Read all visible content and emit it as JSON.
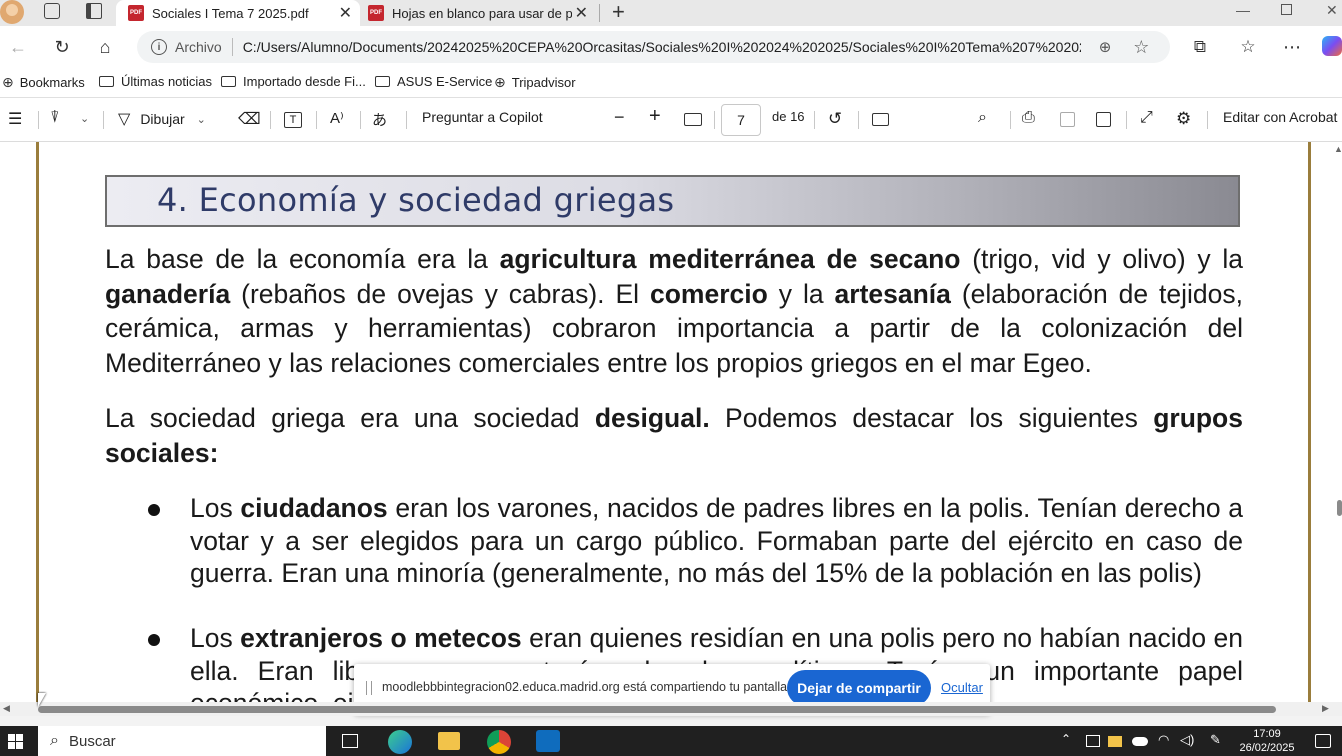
{
  "tabs": [
    {
      "title": "Sociales I Tema 7 2025.pdf",
      "active": true
    },
    {
      "title": "Hojas en blanco para usar de piza",
      "active": false
    }
  ],
  "address": {
    "scheme_label": "Archivo",
    "url": "C:/Users/Alumno/Documents/20242025%20CEPA%20Orcasitas/Sociales%20I%202024%202025/Sociales%20I%20Tema%207%202025..."
  },
  "bookmarks": {
    "items": [
      "Bookmarks",
      "Últimas noticias",
      "Importado desde Fi...",
      "ASUS E-Service",
      "Tripadvisor"
    ]
  },
  "pdf_toolbar": {
    "draw_label": "Dibujar",
    "copilot_label": "Preguntar a Copilot",
    "page_current": "7",
    "page_total_label": "de 16",
    "edit_acrobat_label": "Editar con Acrobat"
  },
  "document": {
    "heading": "4. Economía y sociedad griegas",
    "para1": {
      "s1": "La base de la economía era la ",
      "b1": "agricultura mediterránea de secano",
      "s2": " (trigo, vid y olivo) y la ",
      "b2": "ganadería",
      "s3": " (rebaños de ovejas y cabras). El ",
      "b3": "comercio",
      "s4": " y la ",
      "b4": "artesanía",
      "s5": " (elaboración de tejidos, cerámica, armas y herramientas) cobraron importancia a partir de la colonización del Mediterráneo y las relaciones comerciales entre los propios griegos en el mar Egeo."
    },
    "para2": {
      "s1": "La sociedad griega era una sociedad ",
      "b1": "desigual.",
      "s2": " Podemos destacar los siguientes ",
      "b2": "grupos sociales",
      "s3": ":"
    },
    "bullet1": {
      "s1": "Los ",
      "b1": "ciudadanos",
      "s2": " eran los varones, nacidos de padres libres en la polis. Tenían derecho a votar y a ser elegidos para un cargo público. Formaban parte del ejército en caso de guerra. Eran una minoría (generalmente, no más del 15% de la población en las polis)"
    },
    "bullet2": {
      "s1": "Los ",
      "b1": "extranjeros o metecos",
      "s2": " eran quienes residían en una polis pero no habían nacido en ella. Eran libres, pero no tenían derechos políticos. Tenían un importante papel económico, ejerciendo el comercio y dueños de talleres artesanos."
    }
  },
  "share_notice": {
    "message": "moodlebbbintegracion02.educa.madrid.org está compartiendo tu pantalla.",
    "stop_label": "Dejar de compartir",
    "hide_label": "Ocultar"
  },
  "taskbar": {
    "search_label": "Buscar",
    "time": "17:09",
    "date": "26/02/2025"
  },
  "colors": {
    "accent_blue": "#1a66d2",
    "pdf_red": "#c4262e",
    "heading_blue": "#2f3b68",
    "page_border_gold": "#9a7d3c"
  }
}
